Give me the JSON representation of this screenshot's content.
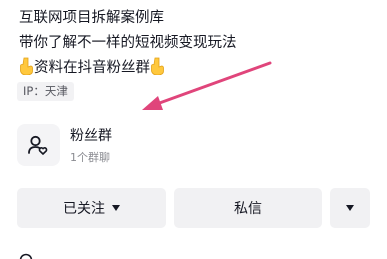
{
  "profile": {
    "bio": {
      "line1": "互联网项目拆解案例库",
      "line2": "带你了解不一样的短视频变现玩法",
      "line3_text": "资料在抖音粉丝群",
      "emoji": "point-down-icon"
    },
    "ip_label": "IP：天津"
  },
  "fan_group": {
    "title": "粉丝群",
    "subtitle": "1个群聊",
    "icon": "group-chat-icon"
  },
  "actions": {
    "followed_label": "已关注",
    "message_label": "私信",
    "more_icon": "caret-down-icon"
  },
  "annotation": {
    "arrow_color": "#e0457b"
  },
  "colors": {
    "text_primary": "#161823",
    "text_secondary": "#8a8b91",
    "button_bg": "#f1f1f3"
  }
}
